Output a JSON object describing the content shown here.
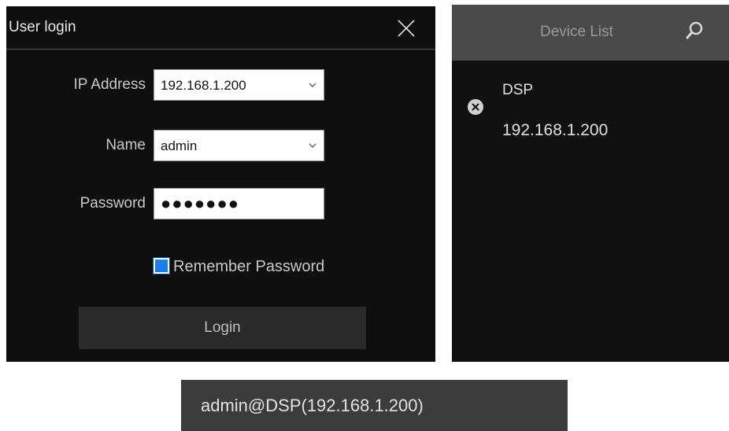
{
  "login_dialog": {
    "title": "User login",
    "ip_address": {
      "label": "IP Address",
      "value": "192.168.1.200"
    },
    "name": {
      "label": "Name",
      "value": "admin"
    },
    "password": {
      "label": "Password",
      "value": "●●●●●●●"
    },
    "remember_password": {
      "label": "Remember Password",
      "checked": true
    },
    "login_button_label": "Login"
  },
  "device_list": {
    "title": "Device List",
    "items": [
      {
        "name": "DSP",
        "ip": "192.168.1.200"
      }
    ]
  },
  "status_bar": {
    "text": "admin@DSP(192.168.1.200)"
  },
  "colors": {
    "panel_bg": "#0f0f0f",
    "accent_checkbox": "#1a7fe8",
    "header_bg": "#4a4a4a",
    "status_bg": "#3c3c3c"
  },
  "icons": [
    "close-icon",
    "chevron-down-icon",
    "search-icon",
    "remove-icon"
  ]
}
